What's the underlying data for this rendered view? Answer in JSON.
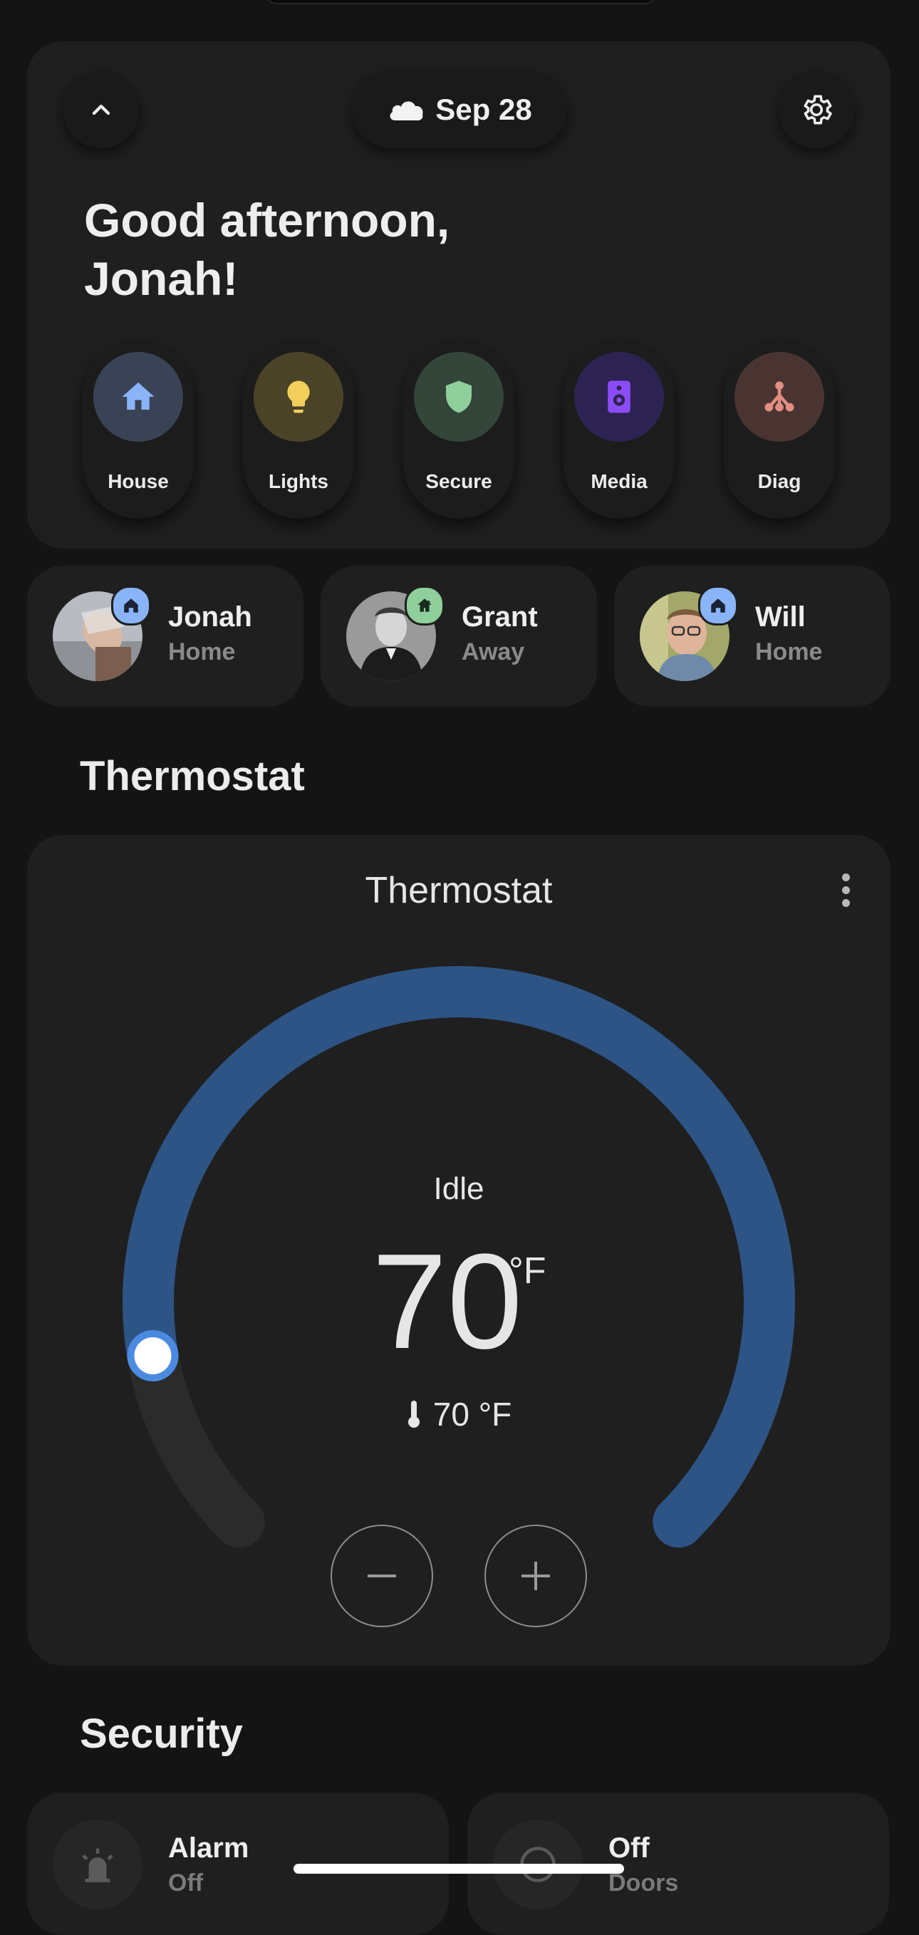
{
  "header": {
    "date_label": "Sep 28",
    "weather_icon": "cloud-icon",
    "greeting": "Good afternoon, Jonah!"
  },
  "nav": [
    {
      "label": "House",
      "icon": "house-icon",
      "color": "#8ab4f8",
      "bg": "#3a4356"
    },
    {
      "label": "Lights",
      "icon": "lightbulb-icon",
      "color": "#f2cf5b",
      "bg": "#4a4327"
    },
    {
      "label": "Secure",
      "icon": "shield-icon",
      "color": "#8fcf9b",
      "bg": "#34453a"
    },
    {
      "label": "Media",
      "icon": "speaker-icon",
      "color": "#8b4cf7",
      "bg": "#2d2352"
    },
    {
      "label": "Diag",
      "icon": "network-icon",
      "color": "#e38e82",
      "bg": "#4a3431"
    }
  ],
  "people": [
    {
      "name": "Jonah",
      "state": "Home",
      "badge_icon": "home-icon",
      "badge_color": "#8ab4f8"
    },
    {
      "name": "Grant",
      "state": "Away",
      "badge_icon": "home-away-icon",
      "badge_color": "#8fcf9b"
    },
    {
      "name": "Will",
      "state": "Home",
      "badge_icon": "home-icon",
      "badge_color": "#8ab4f8"
    }
  ],
  "sections": {
    "thermostat_heading": "Thermostat",
    "security_heading": "Security"
  },
  "thermostat": {
    "title": "Thermostat",
    "hvac_action": "Idle",
    "target_temperature": "70",
    "target_unit": "°F",
    "current_temperature": "70 °F",
    "setpoint_fraction": 0.13,
    "accent_color": "#2d5485"
  },
  "security": [
    {
      "name": "Alarm",
      "state": "Off",
      "icon": "siren-icon"
    },
    {
      "name": "Off",
      "state": "Doors",
      "icon": "circle-icon"
    }
  ]
}
